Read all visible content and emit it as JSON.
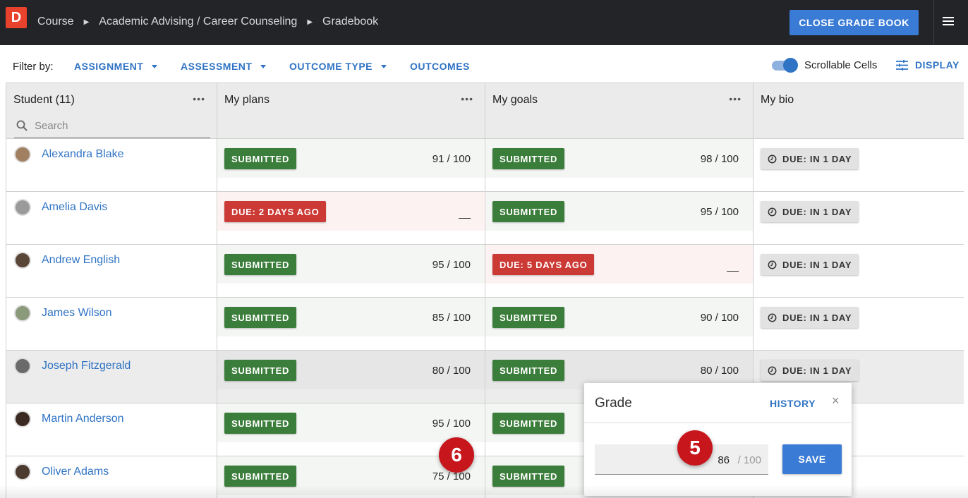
{
  "app": {
    "logo_letter": "D"
  },
  "breadcrumbs": [
    "Course",
    "Academic Advising / Career Counseling",
    "Gradebook"
  ],
  "topbar": {
    "close_label": "CLOSE GRADE BOOK"
  },
  "filter": {
    "label": "Filter by:",
    "items": [
      "ASSIGNMENT",
      "ASSESSMENT",
      "OUTCOME TYPE",
      "OUTCOMES"
    ],
    "toggle_label": "Scrollable Cells",
    "toggle_on": true,
    "display_label": "DISPLAY"
  },
  "columns": {
    "student": "Student (11)",
    "search_placeholder": "Search",
    "plans": "My plans",
    "goals": "My goals",
    "bio": "My bio"
  },
  "rows": [
    {
      "name": "Alexandra Blake",
      "plans_status": "SUBMITTED",
      "plans_score": "91 / 100",
      "goals_status": "SUBMITTED",
      "goals_score": "98 / 100",
      "bio_status": "DUE: IN 1 DAY"
    },
    {
      "name": "Amelia Davis",
      "plans_status": "DUE: 2 DAYS AGO",
      "plans_score": "__",
      "goals_status": "SUBMITTED",
      "goals_score": "95 / 100",
      "bio_status": "DUE: IN 1 DAY"
    },
    {
      "name": "Andrew English",
      "plans_status": "SUBMITTED",
      "plans_score": "95 / 100",
      "goals_status": "DUE: 5 DAYS AGO",
      "goals_score": "__",
      "bio_status": "DUE: IN 1 DAY"
    },
    {
      "name": "James Wilson",
      "plans_status": "SUBMITTED",
      "plans_score": "85 / 100",
      "goals_status": "SUBMITTED",
      "goals_score": "90 / 100",
      "bio_status": "DUE: IN 1 DAY"
    },
    {
      "name": "Joseph Fitzgerald",
      "plans_status": "SUBMITTED",
      "plans_score": "80 / 100",
      "goals_status": "SUBMITTED",
      "goals_score": "80 / 100",
      "bio_status": "DUE: IN 1 DAY"
    },
    {
      "name": "Martin Anderson",
      "plans_status": "SUBMITTED",
      "plans_score": "95 / 100",
      "goals_status": "SUBMITTED",
      "goals_score": "",
      "bio_status": ""
    },
    {
      "name": "Oliver Adams",
      "plans_status": "SUBMITTED",
      "plans_score": "75 / 100",
      "goals_status": "SUBMITTED",
      "goals_score": "",
      "bio_status": ""
    }
  ],
  "popup": {
    "title": "Grade",
    "history_label": "HISTORY",
    "close_glyph": "×",
    "grade_value": "86",
    "grade_max": "/ 100",
    "save_label": "SAVE"
  },
  "markers": {
    "grade_input": "5",
    "plans_score": "6"
  }
}
